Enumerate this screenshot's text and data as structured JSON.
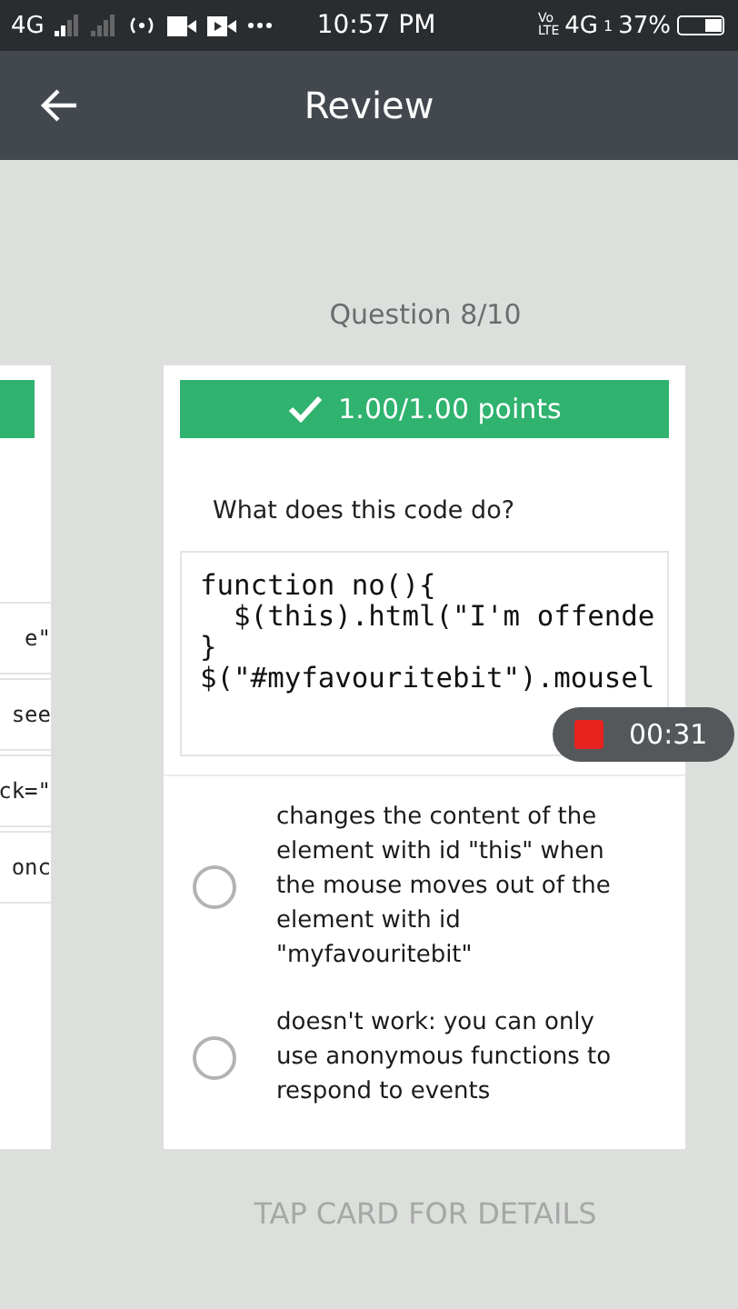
{
  "status_bar": {
    "left_network": "4G",
    "time": "10:57 PM",
    "volte": [
      "Vo",
      "LTE"
    ],
    "network": "4G",
    "sim": "1",
    "battery": "37%"
  },
  "app_bar": {
    "title": "Review"
  },
  "question_label": "Question 8/10",
  "left_card": {
    "correct": true,
    "lines": [
      "e\"",
      "see",
      "ck=\"",
      "onc"
    ]
  },
  "card": {
    "result": {
      "correct": true,
      "points": "1.00/1.00 points"
    },
    "question": "What does this code do?",
    "code": [
      "function no(){",
      "  $(this).html(\"I'm offende",
      "}",
      "$(\"#myfavouritebit\").mousel"
    ],
    "options": [
      {
        "text": "changes the content of the element with id \"this\" when the mouse moves out of the element with id \"myfavouritebit\"",
        "selected": false
      },
      {
        "text": "doesn't work: you can only use anonymous functions to respond to events",
        "selected": false
      }
    ]
  },
  "recording": {
    "time": "00:31"
  },
  "hint": "TAP CARD FOR DETAILS"
}
